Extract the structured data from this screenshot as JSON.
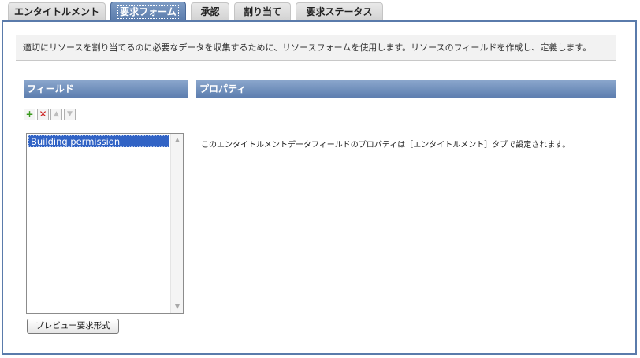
{
  "tabs": [
    {
      "label": "エンタイトルメント",
      "active": false
    },
    {
      "label": "要求フォーム",
      "active": true
    },
    {
      "label": "承認",
      "active": false
    },
    {
      "label": "割り当て",
      "active": false
    },
    {
      "label": "要求ステータス",
      "active": false
    }
  ],
  "description": "適切にリソースを割り当てるのに必要なデータを収集するために、リソースフォームを使用します。リソースのフィールドを作成し、定義します。",
  "fields_section": {
    "header": "フィールド",
    "toolbar": {
      "add_icon": "plus-icon",
      "delete_icon": "x-icon",
      "move_up_icon": "arrow-up-icon",
      "move_down_icon": "arrow-down-icon"
    },
    "items": [
      {
        "label": "Building permission",
        "selected": true
      }
    ],
    "preview_button": "プレビュー要求形式"
  },
  "properties_section": {
    "header": "プロパティ",
    "message": "このエンタイトルメントデータフィールドのプロパティは［エンタイトルメント］タブで設定されます。"
  },
  "colors": {
    "accent": "#5a7bab",
    "selection": "#3163c5"
  }
}
